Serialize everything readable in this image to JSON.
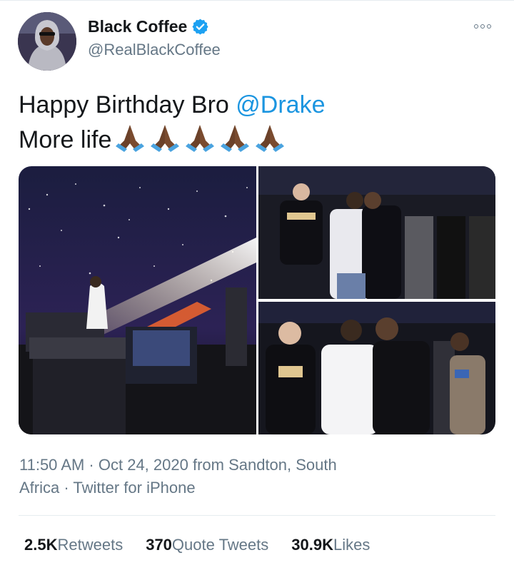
{
  "user": {
    "display_name": "Black Coffee",
    "handle": "@RealBlackCoffee",
    "verified": true
  },
  "tweet": {
    "line1_text": "Happy Birthday Bro ",
    "line1_mention": "@Drake",
    "line2_text": "More life",
    "emoji_name": "folded-hands-emoji",
    "emoji_count": 5
  },
  "photos": [
    {
      "name": "dj-stage-photo"
    },
    {
      "name": "hug-photo-1"
    },
    {
      "name": "hug-photo-2"
    }
  ],
  "meta": {
    "line1": "11:50 AM · Oct 24, 2020 from Sandton, South",
    "line2": "Africa · Twitter for iPhone"
  },
  "stats": {
    "retweets_count": "2.5K",
    "retweets_label": "Retweets",
    "quote_count": "370",
    "quote_label": "Quote Tweets",
    "likes_count": "30.9K",
    "likes_label": "Likes"
  },
  "colors": {
    "link": "#1b95e0",
    "secondary_text": "#657786",
    "verified_badge": "#1da1f2"
  }
}
